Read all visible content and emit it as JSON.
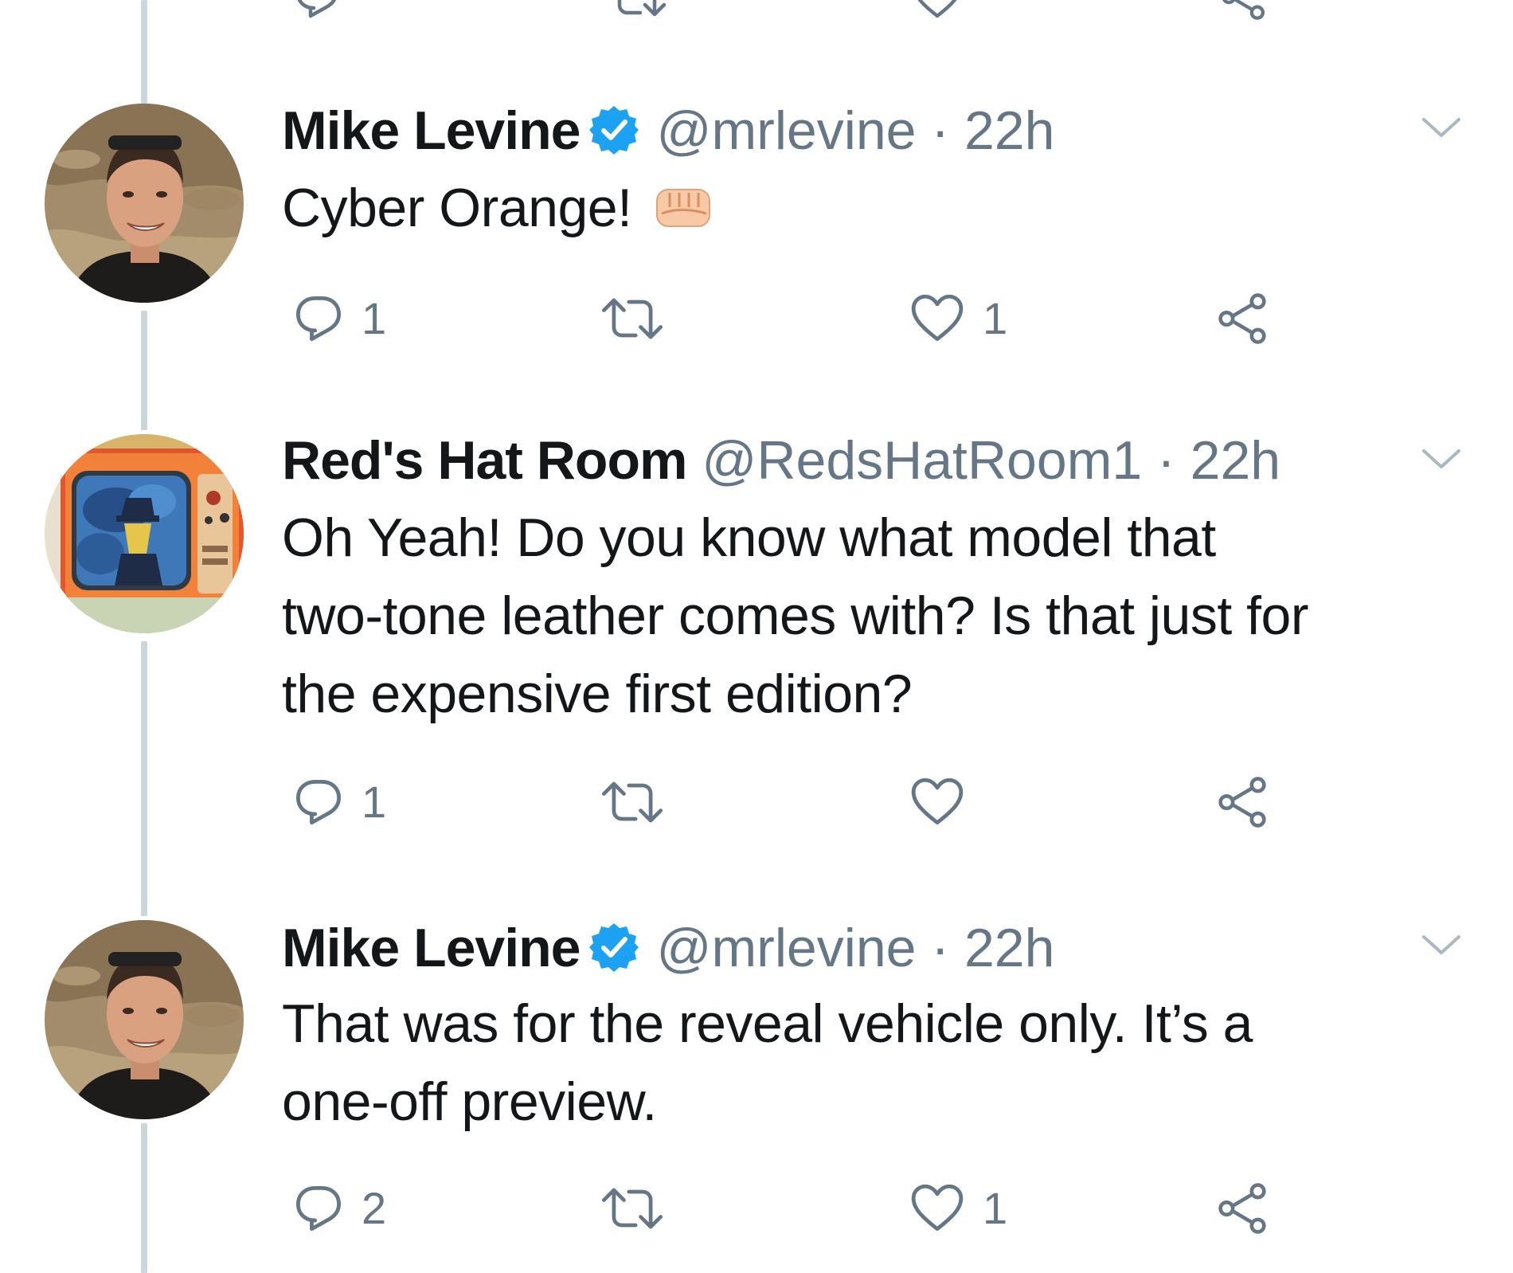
{
  "thread": {
    "tweets": [
      {
        "author_name": "Mike Levine",
        "verified": true,
        "handle": "@mrlevine",
        "separator": "·",
        "time": "22h",
        "text": "Cyber Orange!",
        "emoji": "fist-icon",
        "reply_count": "1",
        "retweet_count": "",
        "like_count": "1",
        "avatar": "mike-levine-avatar"
      },
      {
        "author_name": "Red's Hat Room",
        "verified": false,
        "handle": "@RedsHatRoom1",
        "separator": "·",
        "time": "22h",
        "text_lines": [
          "Oh Yeah!  Do you know what model that",
          "two-tone leather comes with?  Is that just for",
          "the expensive first edition?"
        ],
        "reply_count": "1",
        "retweet_count": "",
        "like_count": "",
        "avatar": "reds-hat-room-avatar"
      },
      {
        "author_name": "Mike Levine",
        "verified": true,
        "handle": "@mrlevine",
        "separator": "·",
        "time": "22h",
        "text_lines": [
          "That was for the reveal vehicle only. It’s a",
          "one-off preview."
        ],
        "reply_count": "2",
        "retweet_count": "",
        "like_count": "1",
        "avatar": "mike-levine-avatar"
      }
    ]
  },
  "icons": {
    "reply": "reply-icon",
    "retweet": "retweet-icon",
    "like": "heart-icon",
    "share": "share-icon",
    "verified": "verified-badge-icon",
    "more": "chevron-down-icon"
  },
  "colors": {
    "text": "#14171a",
    "secondary": "#657786",
    "verified_blue": "#1da1f2",
    "thread_line": "#ccd6dd"
  }
}
